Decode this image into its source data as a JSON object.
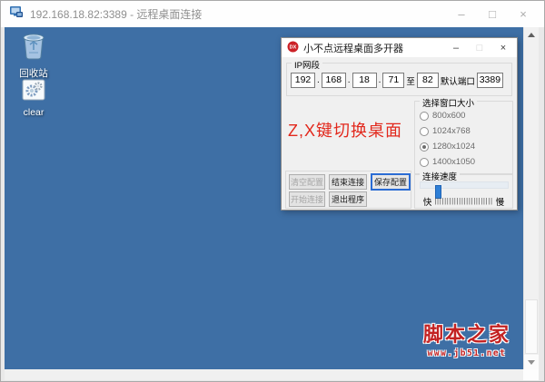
{
  "window": {
    "title": "192.168.18.82:3389 - 远程桌面连接",
    "minimize": "–",
    "maximize": "□",
    "close": "×"
  },
  "desktop": {
    "icons": [
      {
        "label": "回收站"
      },
      {
        "label": "clear"
      }
    ],
    "watermark": {
      "title": "脚本之家",
      "url": "www.jb51.net"
    }
  },
  "dialog": {
    "title": "小不点远程桌面多开器",
    "minimize": "–",
    "maximize": "□",
    "close": "×",
    "ip": {
      "label": "IP网段",
      "octet1": "192",
      "octet2": "168",
      "octet3": "18",
      "dot": ".",
      "range_start": "71",
      "to": "至",
      "range_end": "82",
      "port_label": "默认端口",
      "port": "3389"
    },
    "hint": "Z,X键切换桌面",
    "size": {
      "label": "选择窗口大小",
      "selected": "1280x1024",
      "options": [
        {
          "label": "800x600",
          "selected": false
        },
        {
          "label": "1024x768",
          "selected": false
        },
        {
          "label": "1280x1024",
          "selected": true
        },
        {
          "label": "1400x1050",
          "selected": false
        }
      ]
    },
    "buttons": {
      "clear_config": "清空配置",
      "end_connection": "结束连接",
      "save_config": "保存配置",
      "start_connection": "开始连接",
      "exit_program": "退出程序"
    },
    "speed": {
      "label": "连接速度",
      "fast": "快",
      "slow": "慢",
      "ticks": "||||||||||||||||||||||||"
    }
  },
  "colors": {
    "desktop_blue": "#3E6FA5",
    "hint_red": "#E2281C",
    "watermark_red": "#C32222",
    "focus_blue": "#2B6CD4",
    "slider_blue": "#2F7FD6"
  }
}
